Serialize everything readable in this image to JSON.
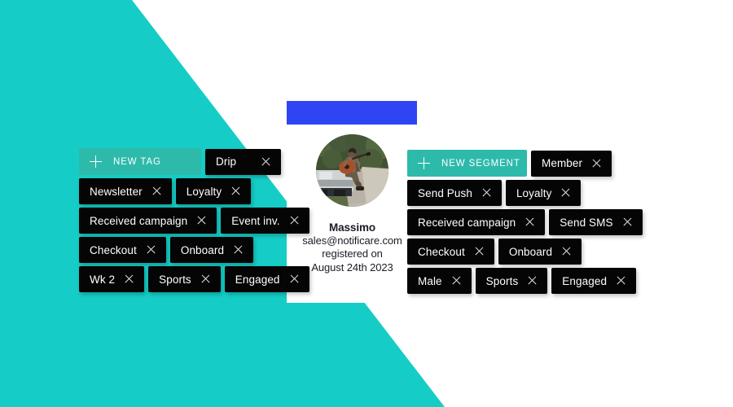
{
  "theme": {
    "teal_background": "#15cdc6",
    "teal_button": "#2dbaab",
    "chip_background": "#050505",
    "chip_text": "#ffffff",
    "accent_blue": "#2f45f3",
    "page_background": "#ffffff"
  },
  "profile": {
    "name": "Massimo",
    "email": "sales@notificare.com",
    "registered_label": "registered on",
    "registered_date": "August 24th 2023",
    "avatar_alt": "man playing acoustic guitar sitting on pickup truck hood on forest road"
  },
  "tags_panel": {
    "add_button": {
      "label": "NEW TAG",
      "icon": "plus-icon"
    },
    "remove_icon": "close-icon",
    "rows": [
      [
        {
          "label": "Drip",
          "wide_gap": true
        }
      ],
      [
        {
          "label": "Newsletter"
        },
        {
          "label": "Loyalty"
        }
      ],
      [
        {
          "label": "Received campaign"
        },
        {
          "label": "Event inv."
        }
      ],
      [
        {
          "label": "Checkout"
        },
        {
          "label": "Onboard"
        }
      ],
      [
        {
          "label": "Wk 2"
        },
        {
          "label": "Sports"
        },
        {
          "label": "Engaged"
        }
      ]
    ]
  },
  "segments_panel": {
    "add_button": {
      "label": "NEW SEGMENT",
      "icon": "plus-icon"
    },
    "remove_icon": "close-icon",
    "rows": [
      [
        {
          "label": "Member"
        }
      ],
      [
        {
          "label": "Send Push"
        },
        {
          "label": "Loyalty"
        }
      ],
      [
        {
          "label": "Received campaign"
        },
        {
          "label": "Send SMS"
        }
      ],
      [
        {
          "label": "Checkout"
        },
        {
          "label": "Onboard"
        }
      ],
      [
        {
          "label": "Male"
        },
        {
          "label": "Sports"
        },
        {
          "label": "Engaged"
        }
      ]
    ]
  }
}
